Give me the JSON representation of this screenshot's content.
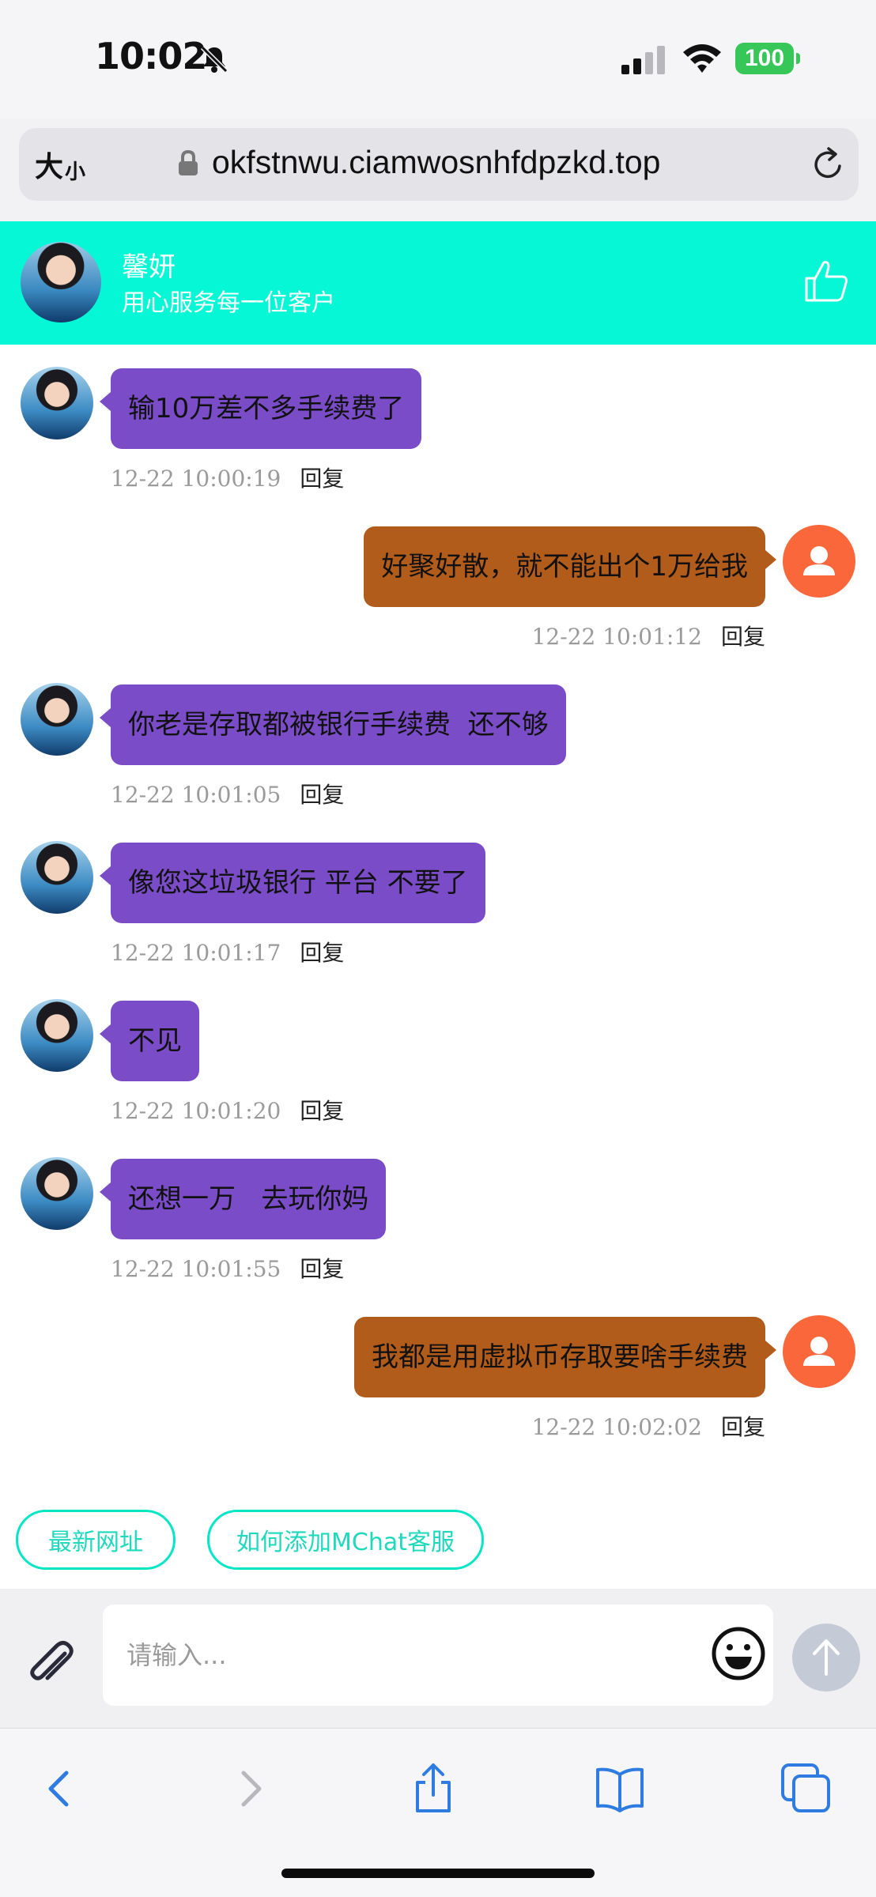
{
  "status_bar": {
    "time": "10:02",
    "battery": "100"
  },
  "address_bar": {
    "text_size_large": "大",
    "text_size_small": "小",
    "url": "okfstnwu.ciamwosnhfdpzkd.top"
  },
  "header": {
    "agent_name": "馨妍",
    "tagline": "用心服务每一位客户"
  },
  "messages": [
    {
      "sender": "agent",
      "text": "输10万差不多手续费了",
      "time": "12-22 10:00:19",
      "reply": "回复"
    },
    {
      "sender": "user",
      "text": "好聚好散，就不能出个1万给我",
      "time": "12-22 10:01:12",
      "reply": "回复"
    },
    {
      "sender": "agent",
      "text": "你老是存取都被银行手续费  还不够",
      "time": "12-22 10:01:05",
      "reply": "回复"
    },
    {
      "sender": "agent",
      "text": "像您这垃圾银行 平台 不要了",
      "time": "12-22 10:01:17",
      "reply": "回复"
    },
    {
      "sender": "agent",
      "text": "不见",
      "time": "12-22 10:01:20",
      "reply": "回复"
    },
    {
      "sender": "agent",
      "text": "还想一万   去玩你妈",
      "time": "12-22 10:01:55",
      "reply": "回复"
    },
    {
      "sender": "user",
      "text": "我都是用虚拟币存取要啥手续费",
      "time": "12-22 10:02:02",
      "reply": "回复"
    }
  ],
  "quick_replies": [
    "最新网址",
    "如何添加MChat客服"
  ],
  "input": {
    "placeholder": "请输入...",
    "value": ""
  },
  "colors": {
    "header_bg": "#06f7d5",
    "agent_bubble": "#7a4cc8",
    "user_bubble": "#b25c1c",
    "user_avatar": "#f9673b",
    "quick_reply_border": "#06e6c6",
    "battery": "#37c759",
    "toolbar_icon": "#2f7ce0"
  },
  "icons": {
    "status": [
      "bell-slash-icon",
      "signal-icon",
      "wifi-icon",
      "battery-icon"
    ],
    "address": [
      "lock-icon",
      "reload-icon"
    ],
    "header": [
      "thumbs-up-icon"
    ],
    "input": [
      "paperclip-icon",
      "emoji-icon",
      "send-arrow-icon"
    ],
    "toolbar": [
      "back-icon",
      "forward-icon",
      "share-icon",
      "bookmarks-icon",
      "tabs-icon"
    ]
  }
}
